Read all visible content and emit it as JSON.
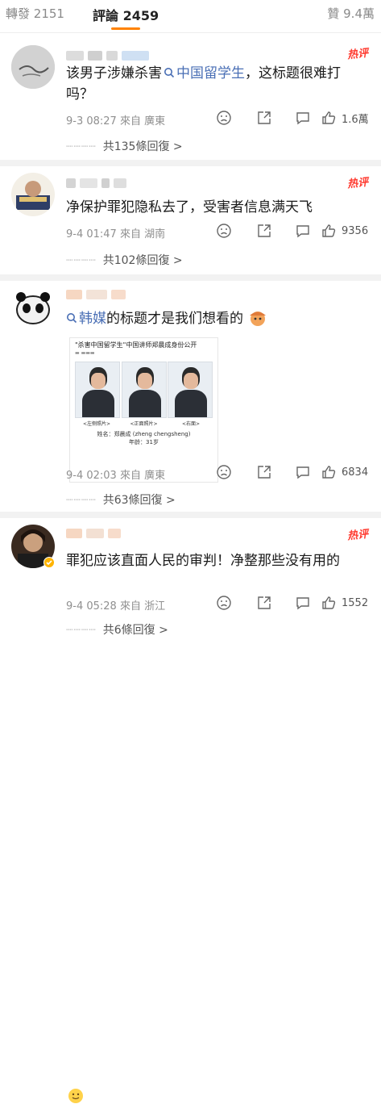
{
  "tabs": {
    "reposts_label": "轉發",
    "reposts_count": "2151",
    "comments_label": "評論",
    "comments_count": "2459",
    "likes_label": "贊",
    "likes_count": "9.4萬"
  },
  "hot_label": "热评",
  "colors": {
    "accent": "#ff8200",
    "topic_link": "#4a6fb5",
    "hot": "#ff3b30"
  },
  "comments": [
    {
      "text_before": "该男子涉嫌杀害",
      "topic": "中国留学生",
      "text_after": "，这标题很难打吗？",
      "date": "9-3 08:27",
      "source": "來自 廣東",
      "likes": "1.6萬",
      "replies": "共135條回復 >"
    },
    {
      "text": "净保护罪犯隐私去了，受害者信息满天飞",
      "date": "9-4 01:47",
      "source": "來自 湖南",
      "likes": "9356",
      "replies": "共102條回復 >"
    },
    {
      "topic": "韩媒",
      "text_after": "的标题才是我们想看的",
      "date": "9-4 02:03",
      "source": "來自 廣東",
      "likes": "6834",
      "replies": "共63條回復 >",
      "embed": {
        "headline": "\"杀害中国留学生\"中国讲师郑晨成身份公开",
        "captions": [
          "<左侧照片>",
          "<正面照片>",
          "<右面>"
        ],
        "name_line": "姓名：郑晨成 (zheng chengsheng)",
        "age_line": "年龄：31岁"
      }
    },
    {
      "text": "罪犯应该直面人民的审判！净整那些没有用的",
      "date": "9-4 05:28",
      "source": "來自 浙江",
      "likes": "1552",
      "replies": "共6條回復 >"
    }
  ]
}
